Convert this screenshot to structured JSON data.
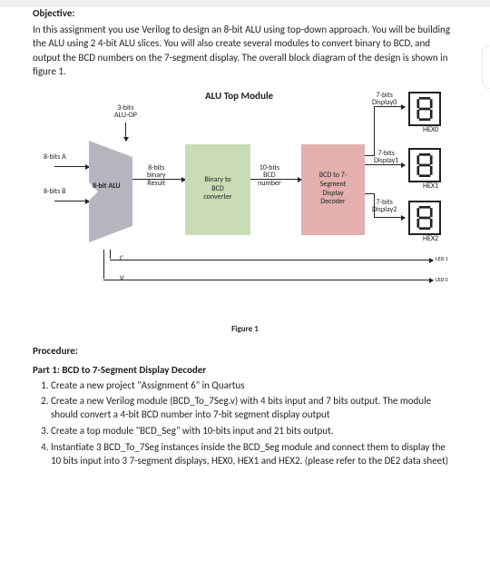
{
  "doc": {
    "objective_h": "Objective:",
    "objective_p": "In this assignment you use Verilog to design an 8-bit ALU using top-down approach. You will be building the ALU using 2 4-bit ALU slices. You will also create several modules to convert binary to BCD, and output the BCD numbers on the 7-segment display.  The overall block diagram of the design is shown in figure 1.",
    "proc_h": "Procedure:",
    "part1_h": "Part 1: BCD to 7-Segment Display Decoder",
    "steps": [
      "Create a new project \"Assignment 6\" in Quartus",
      "Create a new Verilog module (BCD_To_7Seg.v) with 4 bits input and 7 bits output. The module should convert a 4-bit BCD number into 7-bit segment display output",
      "Create a top module \"BCD_Seg\" with 10-bits input and 21 bits output.",
      "Instantiate 3 BCD_To_7Seg instances inside the BCD_Seg module and connect them to display the 10 bits input into 3 7-segment displays, HEX0, HEX1 and HEX2. (please refer to the DE2 data sheet)"
    ],
    "figcap": "Figure 1"
  },
  "dg": {
    "title": "ALU Top Module",
    "aluop": "3-bits\nALU-OP",
    "inA": "8-bits A",
    "inB": "8-bits B",
    "alu": "8-bit ALU",
    "aluout": "8-bits\nbinary\nResult",
    "b2bcd": "Binary to\nBCD\nconverter",
    "bcdout": "10-bits\nBCD\nnumber",
    "dec": "BCD to 7-\nSegment\nDisplay\nDecoder",
    "d0": "7-bits\nDisplay0",
    "h0": "HEX0",
    "d1": "7-bits\nDisplay1",
    "h1": "HEX1",
    "d2": "7-bits\nDisplay2",
    "h2": "HEX2",
    "c": "C",
    "v": "V",
    "led0": "LED 0",
    "led1": "LED 1"
  }
}
